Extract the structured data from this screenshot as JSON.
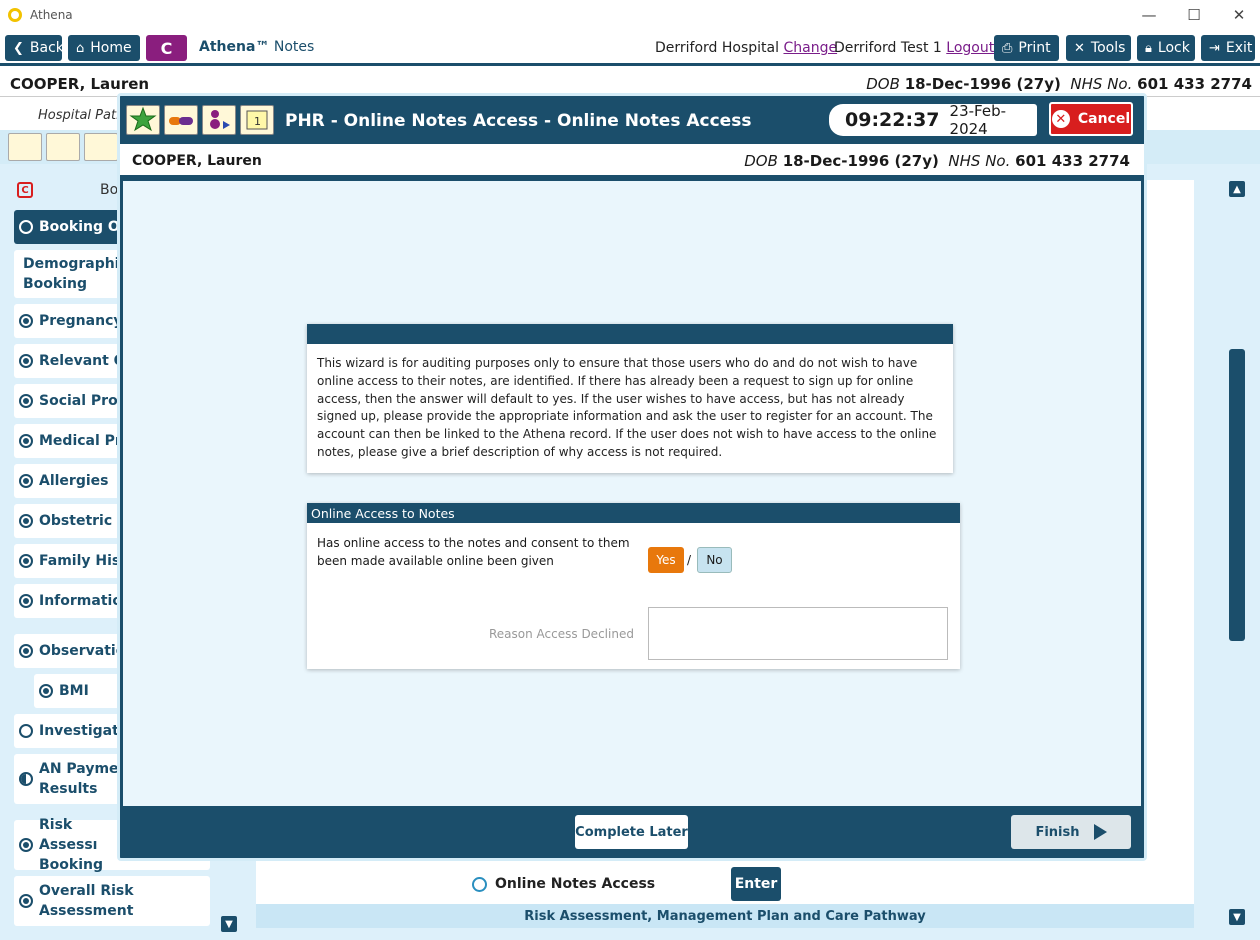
{
  "window": {
    "title": "Athena",
    "minimize": "—",
    "maximize": "☐",
    "close": "✕"
  },
  "toolbar": {
    "back": "Back",
    "home": "Home",
    "c_button": "C",
    "brand": "Athena™",
    "brand_suffix": "Notes",
    "hospital": "Derriford Hospital",
    "change": "Change",
    "user": "Derriford Test 1",
    "logout": "Logout",
    "print": "Print",
    "tools": "Tools",
    "lock": "Lock",
    "exit": "Exit"
  },
  "patient": {
    "name": "COOPER, Lauren",
    "dob_label": "DOB",
    "dob": "18-Dec-1996 (27y)",
    "nhs_label": "NHS No.",
    "nhs": "601 433 2774"
  },
  "background": {
    "hospital_patient": "Hospital Patie",
    "booking_header": "Bo",
    "nav": [
      {
        "label": "Booking Ov",
        "state": "active"
      },
      {
        "label": "Demographics Booking",
        "state": "none"
      },
      {
        "label": "Pregnancy I",
        "state": "filled"
      },
      {
        "label": "Relevant Ot",
        "state": "filled"
      },
      {
        "label": "Social Profil",
        "state": "filled"
      },
      {
        "label": "Medical Pro",
        "state": "filled"
      },
      {
        "label": "Allergies",
        "state": "filled"
      },
      {
        "label": "Obstetric H",
        "state": "filled"
      },
      {
        "label": "Family Histo",
        "state": "filled"
      },
      {
        "label": "Information",
        "state": "filled"
      },
      {
        "label": "Observation",
        "state": "filled"
      },
      {
        "label": "BMI",
        "state": "filled"
      },
      {
        "label": "Investigatio",
        "state": "empty"
      },
      {
        "label": "AN Paymen Results",
        "state": "half"
      },
      {
        "label": "Risk Assessı Booking",
        "state": "filled"
      },
      {
        "label": "Overall Risk Assessment",
        "state": "filled"
      }
    ],
    "online_notes_access": "Online Notes Access",
    "enter": "Enter",
    "risk_bar": "Risk Assessment, Management Plan and Care Pathway"
  },
  "modal": {
    "title": "PHR - Online Notes Access - Online Notes Access",
    "time": "09:22:37",
    "date": "23-Feb-2024",
    "cancel": "Cancel",
    "info_text": "This wizard is for auditing purposes only to ensure that those users who do and do not wish to have online access to their notes, are identified. If there has already been a request to sign up for online access, then the answer will default to yes. If the user wishes to have access, but has not already signed up, please provide the appropriate information and ask the user to register for an account. The account can then be linked to the Athena record. If the user does not wish to have access to the online notes, please give a brief description of why access is not required.",
    "section_title": "Online Access to Notes",
    "question": "Has online access to the notes and consent to them been made available online been given",
    "yes": "Yes",
    "slash": "/",
    "no": "No",
    "reason_label": "Reason Access Declined",
    "reason_value": "",
    "complete_later": "Complete Later",
    "finish": "Finish"
  },
  "colors": {
    "primary": "#1b4e6b",
    "accent_purple": "#8a1e7e",
    "cancel_red": "#d81e1e",
    "yes_orange": "#e8780c",
    "bg_light_blue": "#ddf0fa"
  }
}
